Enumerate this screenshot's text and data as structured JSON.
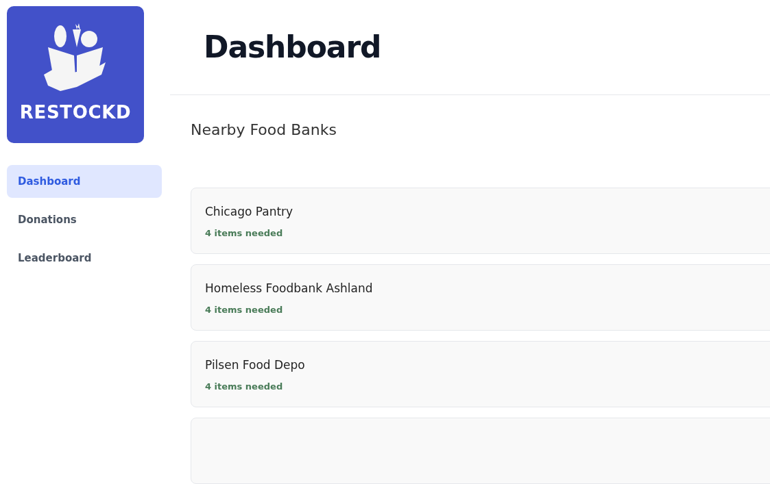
{
  "logo": {
    "text": "RESTOCKD"
  },
  "sidebar": {
    "items": [
      {
        "label": "Dashboard",
        "selected": true
      },
      {
        "label": "Donations",
        "selected": false
      },
      {
        "label": "Leaderboard",
        "selected": false
      }
    ]
  },
  "header": {
    "title": "Dashboard"
  },
  "section": {
    "title": "Nearby Food Banks"
  },
  "food_banks": [
    {
      "name": "Chicago Pantry",
      "status": "4 items needed"
    },
    {
      "name": "Homeless Foodbank Ashland",
      "status": "4 items needed"
    },
    {
      "name": "Pilsen Food Depo",
      "status": "4 items needed"
    }
  ]
}
